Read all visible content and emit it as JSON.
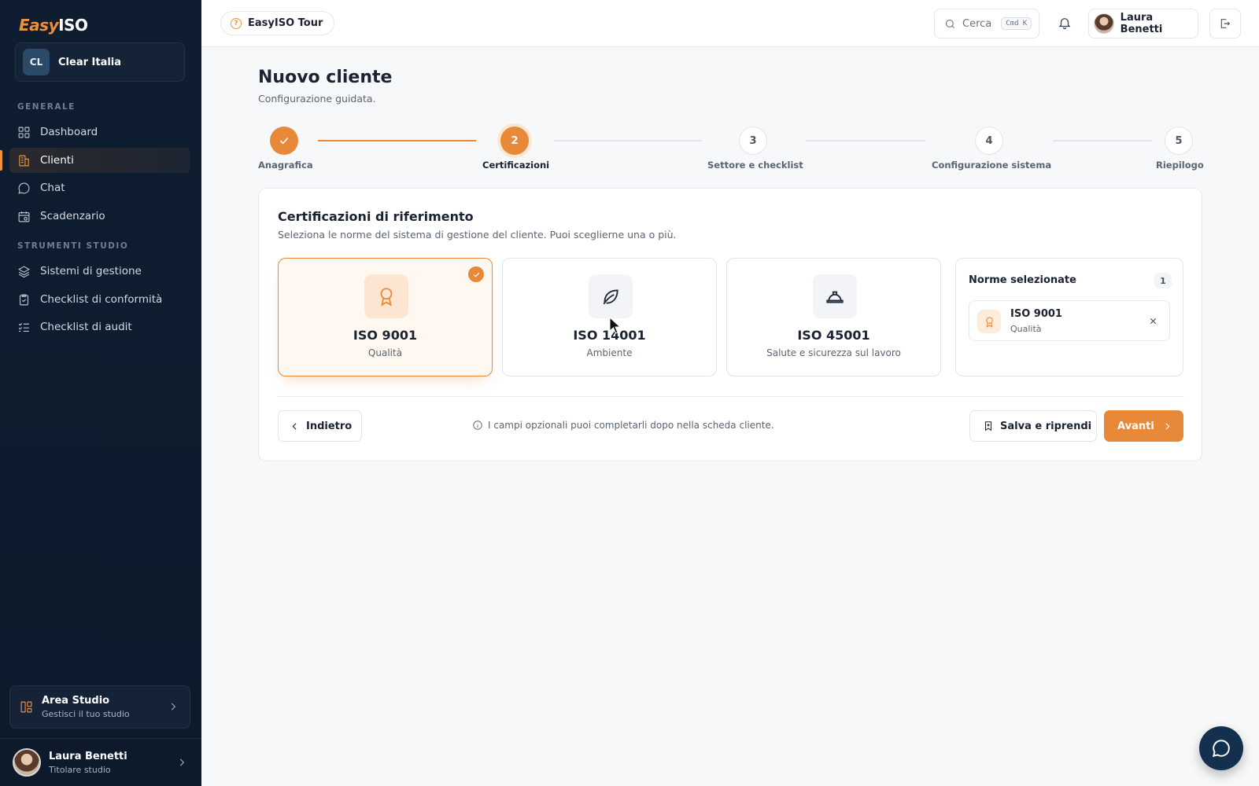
{
  "brand": {
    "logo_part1": "Easy",
    "logo_part2": "ISO"
  },
  "org": {
    "initials": "CL",
    "name": "Clear Italia"
  },
  "sidebar": {
    "section1": "GENERALE",
    "section2": "STRUMENTI STUDIO",
    "items": [
      {
        "label": "Dashboard",
        "icon": "grid-icon"
      },
      {
        "label": "Clienti",
        "icon": "building-icon",
        "active": true
      },
      {
        "label": "Chat",
        "icon": "chat-icon"
      },
      {
        "label": "Scadenzario",
        "icon": "calendar-icon"
      },
      {
        "label": "Sistemi di gestione",
        "icon": "layers-icon"
      },
      {
        "label": "Checklist di conformità",
        "icon": "clipboard-check-icon"
      },
      {
        "label": "Checklist di audit",
        "icon": "list-check-icon"
      }
    ],
    "area": {
      "title": "Area Studio",
      "subtitle": "Gestisci il tuo studio"
    },
    "user": {
      "name": "Laura Benetti",
      "role": "Titolare studio"
    }
  },
  "topbar": {
    "tour_label": "EasyISO Tour",
    "search_placeholder": "Cerca",
    "shortcut": "Cmd K",
    "user_name": "Laura Benetti"
  },
  "page": {
    "title": "Nuovo cliente",
    "subtitle": "Configurazione guidata."
  },
  "stepper": [
    {
      "num": "1",
      "label": "Anagrafica",
      "state": "done"
    },
    {
      "num": "2",
      "label": "Certificazioni",
      "state": "current"
    },
    {
      "num": "3",
      "label": "Settore e checklist",
      "state": "todo"
    },
    {
      "num": "4",
      "label": "Configurazione sistema",
      "state": "todo"
    },
    {
      "num": "5",
      "label": "Riepilogo",
      "state": "todo"
    }
  ],
  "certs_section": {
    "title": "Certificazioni di riferimento",
    "subtitle": "Seleziona le norme del sistema di gestione del cliente. Puoi sceglierne una o più.",
    "options": [
      {
        "name": "ISO 9001",
        "desc": "Qualità",
        "icon": "award-icon",
        "selected": true
      },
      {
        "name": "ISO 14001",
        "desc": "Ambiente",
        "icon": "leaf-icon",
        "selected": false
      },
      {
        "name": "ISO 45001",
        "desc": "Salute e sicurezza sul lavoro",
        "icon": "hard-hat-icon",
        "selected": false
      }
    ],
    "selected_panel": {
      "title": "Norme selezionate",
      "count": "1",
      "items": [
        {
          "name": "ISO 9001",
          "desc": "Qualità"
        }
      ]
    }
  },
  "footer": {
    "back_label": "Indietro",
    "hint": "I campi opzionali puoi completarli dopo nella scheda cliente.",
    "save_label": "Salva e riprendi",
    "next_label": "Avanti"
  },
  "colors": {
    "accent": "#e8893a",
    "sidebar_bg": "#0f1d31",
    "fab": "#14304f"
  }
}
